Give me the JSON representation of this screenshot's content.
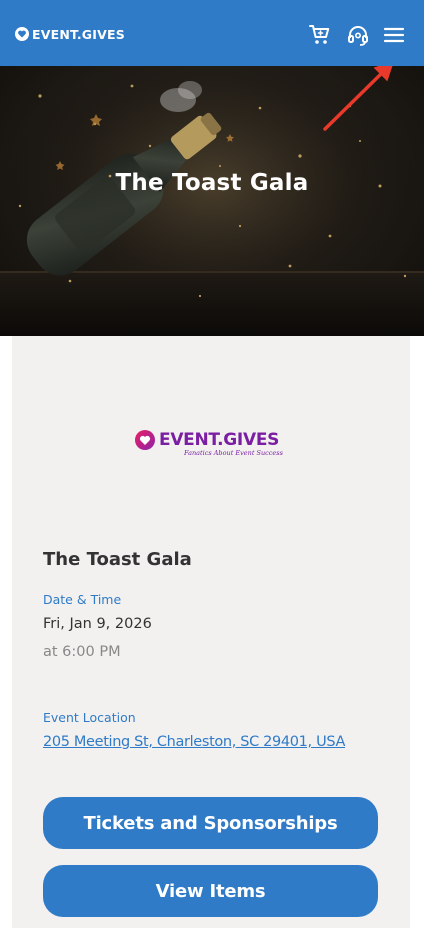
{
  "header": {
    "logo_text": "EVENT.GIVES",
    "icons": [
      "cart-icon",
      "support-icon",
      "menu-icon"
    ],
    "background_color": "#2f7bc7"
  },
  "hero": {
    "title": "The Toast Gala"
  },
  "card": {
    "logo": {
      "brand": "EVENT.GIVES",
      "tagline": "Fanatics About Event Success"
    },
    "event_title": "The Toast Gala",
    "date_label": "Date & Time",
    "date_value": "Fri, Jan 9, 2026",
    "time_value": "at 6:00 PM",
    "location_label": "Event Location",
    "location_value": "205 Meeting St, Charleston, SC 29401, USA",
    "buttons": {
      "tickets": "Tickets and Sponsorships",
      "items": "View Items"
    }
  },
  "colors": {
    "accent": "#2f7bc7",
    "brand_purple": "#7b1fa2",
    "annotation_arrow": "#e8392b"
  }
}
